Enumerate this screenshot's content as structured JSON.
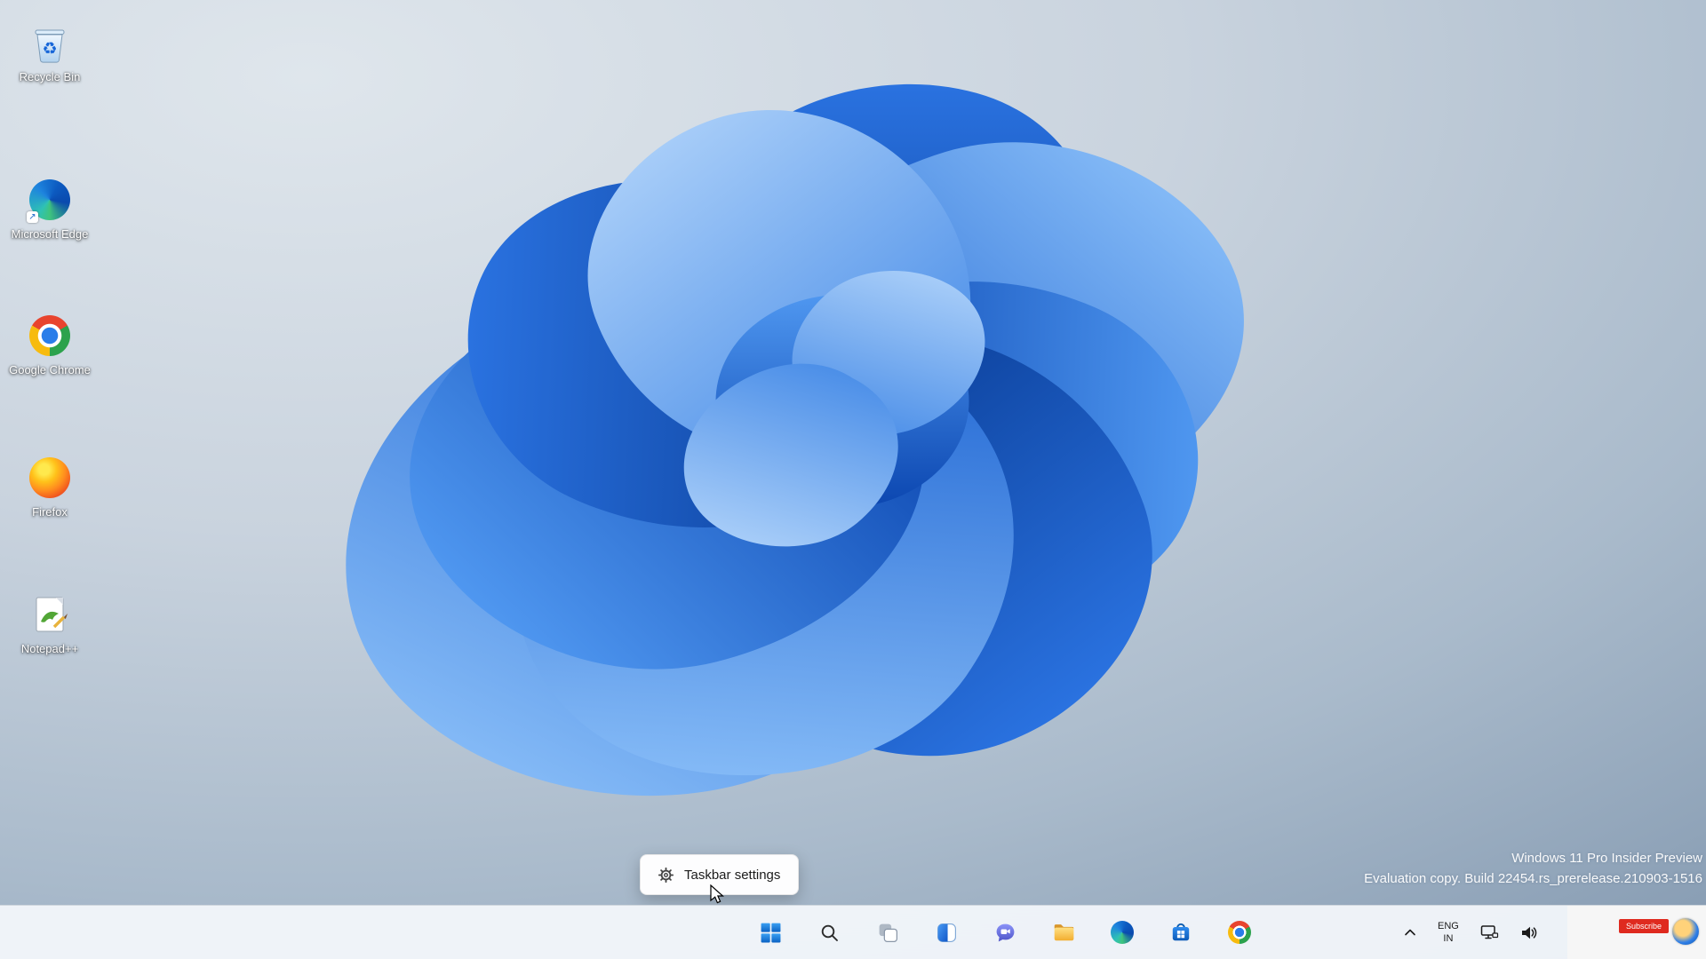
{
  "desktop": {
    "icons": [
      {
        "label": "Recycle Bin"
      },
      {
        "label": "Microsoft Edge"
      },
      {
        "label": "Google Chrome"
      },
      {
        "label": "Firefox"
      },
      {
        "label": "Notepad++"
      }
    ]
  },
  "context_menu": {
    "taskbar_settings": "Taskbar settings"
  },
  "watermark": {
    "line1": "Windows 11 Pro Insider Preview",
    "line2": "Evaluation copy. Build 22454.rs_prerelease.210903-1516"
  },
  "taskbar": {
    "buttons": [
      "start",
      "search",
      "task-view",
      "widgets",
      "chat",
      "file-explorer",
      "edge",
      "store",
      "chrome"
    ],
    "tray": {
      "language_line1": "ENG",
      "language_line2": "IN"
    }
  },
  "overlay": {
    "subscribe": "Subscribe"
  },
  "colors": {
    "subscribe_red": "#df2a1f",
    "taskbar_bg": "#f3f6fb"
  }
}
